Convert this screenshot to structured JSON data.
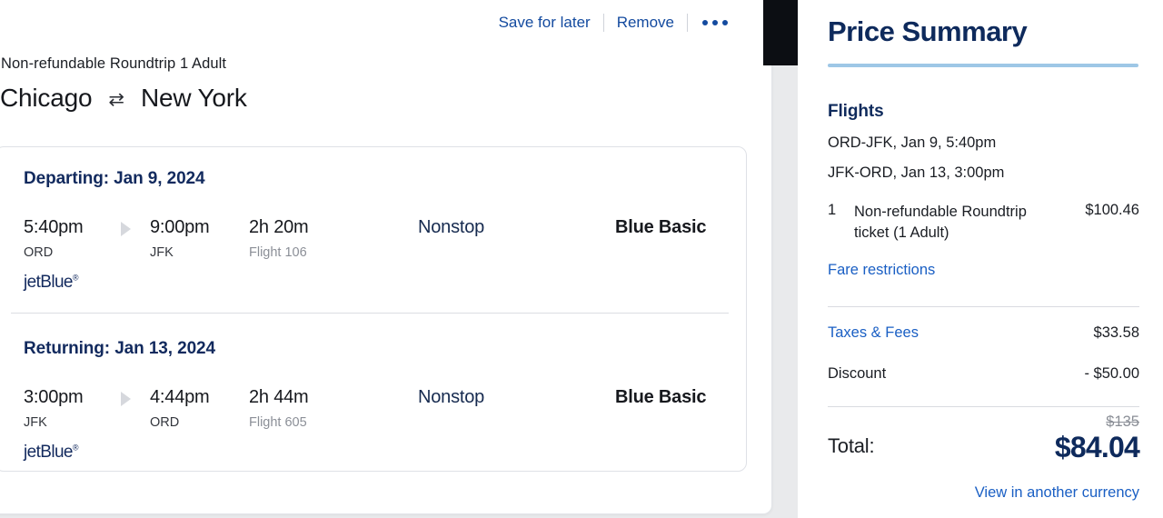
{
  "itinerary": {
    "actions": {
      "save_label": "Save for later",
      "remove_label": "Remove",
      "more_label": "more-options"
    },
    "fare_label": "Non-refundable Roundtrip 1 Adult",
    "origin_city": "Chicago",
    "destination_city": "New York",
    "swap_icon": "⇄",
    "legs": [
      {
        "title": "Departing: Jan 9, 2024",
        "depart_time": "5:40pm",
        "depart_code": "ORD",
        "arrive_time": "9:00pm",
        "arrive_code": "JFK",
        "duration": "2h 20m",
        "flight_number": "Flight 106",
        "stops": "Nonstop",
        "cabin": "Blue Basic",
        "airline": "jetBlue",
        "airline_tm": "®"
      },
      {
        "title": "Returning: Jan 13, 2024",
        "depart_time": "3:00pm",
        "depart_code": "JFK",
        "arrive_time": "4:44pm",
        "arrive_code": "ORD",
        "duration": "2h 44m",
        "flight_number": "Flight 605",
        "stops": "Nonstop",
        "cabin": "Blue Basic",
        "airline": "jetBlue",
        "airline_tm": "®"
      }
    ]
  },
  "price_summary": {
    "title": "Price Summary",
    "flights_heading": "Flights",
    "flight_lines": [
      "ORD-JFK, Jan 9, 5:40pm",
      "JFK-ORD, Jan 13, 3:00pm"
    ],
    "ticket_qty": "1",
    "ticket_desc": "Non-refundable Roundtrip ticket (1 Adult)",
    "ticket_price": "$100.46",
    "fare_restrictions_label": "Fare restrictions",
    "taxes_label": "Taxes & Fees",
    "taxes_value": "$33.58",
    "discount_label": "Discount",
    "discount_value": "- $50.00",
    "total_label": "Total:",
    "total_strikethrough": "$135",
    "total_amount": "$84.04",
    "currency_link_label": "View in another currency"
  },
  "colors": {
    "brand_navy": "#0e2a5c",
    "link_blue": "#1a5fc4",
    "accent_rule": "#9ec7e6",
    "page_bg": "#e9eaec"
  }
}
